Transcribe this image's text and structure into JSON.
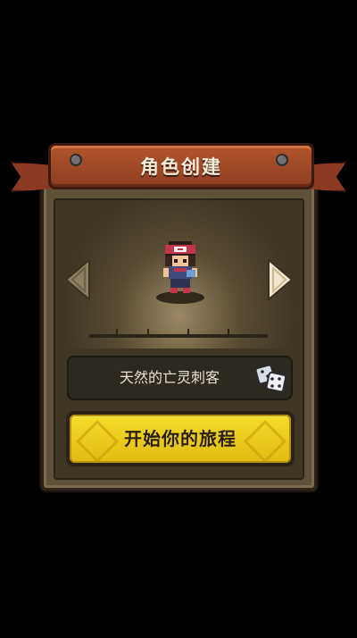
{
  "banner": {
    "title": "角色创建"
  },
  "name_field": {
    "value": "天然的亡灵刺客"
  },
  "start_button": {
    "label": "开始你的旅程"
  },
  "colors": {
    "background": "#000000",
    "panel": "#5d5139",
    "banner": "#a44a27",
    "button": "#f0cf1e"
  },
  "icons": {
    "prev": "arrow-left-icon",
    "next": "arrow-right-icon",
    "randomize": "dice-icon"
  }
}
